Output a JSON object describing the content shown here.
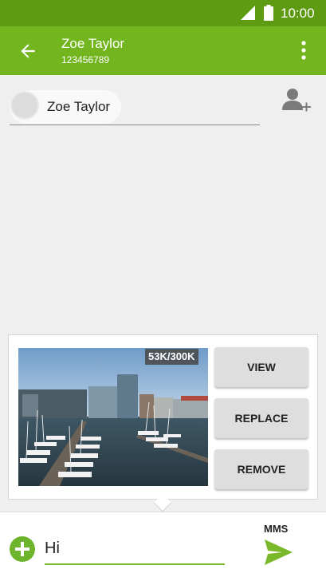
{
  "status_bar": {
    "time": "10:00",
    "icons": [
      "signal-icon",
      "battery-icon"
    ]
  },
  "app_bar": {
    "title": "Zoe Taylor",
    "subtitle": "123456789",
    "icons": [
      "back-arrow-icon",
      "more-vert-icon"
    ]
  },
  "recipient": {
    "name": "Zoe Taylor",
    "icons": [
      "avatar",
      "add-contact-icon"
    ]
  },
  "attachment": {
    "size_label": "53K/300K",
    "actions": {
      "view": "VIEW",
      "replace": "REPLACE",
      "remove": "REMOVE"
    }
  },
  "compose": {
    "text": "Hi",
    "message_type": "MMS",
    "icons": [
      "add-attachment-icon",
      "send-icon"
    ]
  },
  "colors": {
    "status_bar": "#5e9a12",
    "app_bar": "#72b51f",
    "accent": "#7cb82c",
    "background": "#efefef"
  }
}
